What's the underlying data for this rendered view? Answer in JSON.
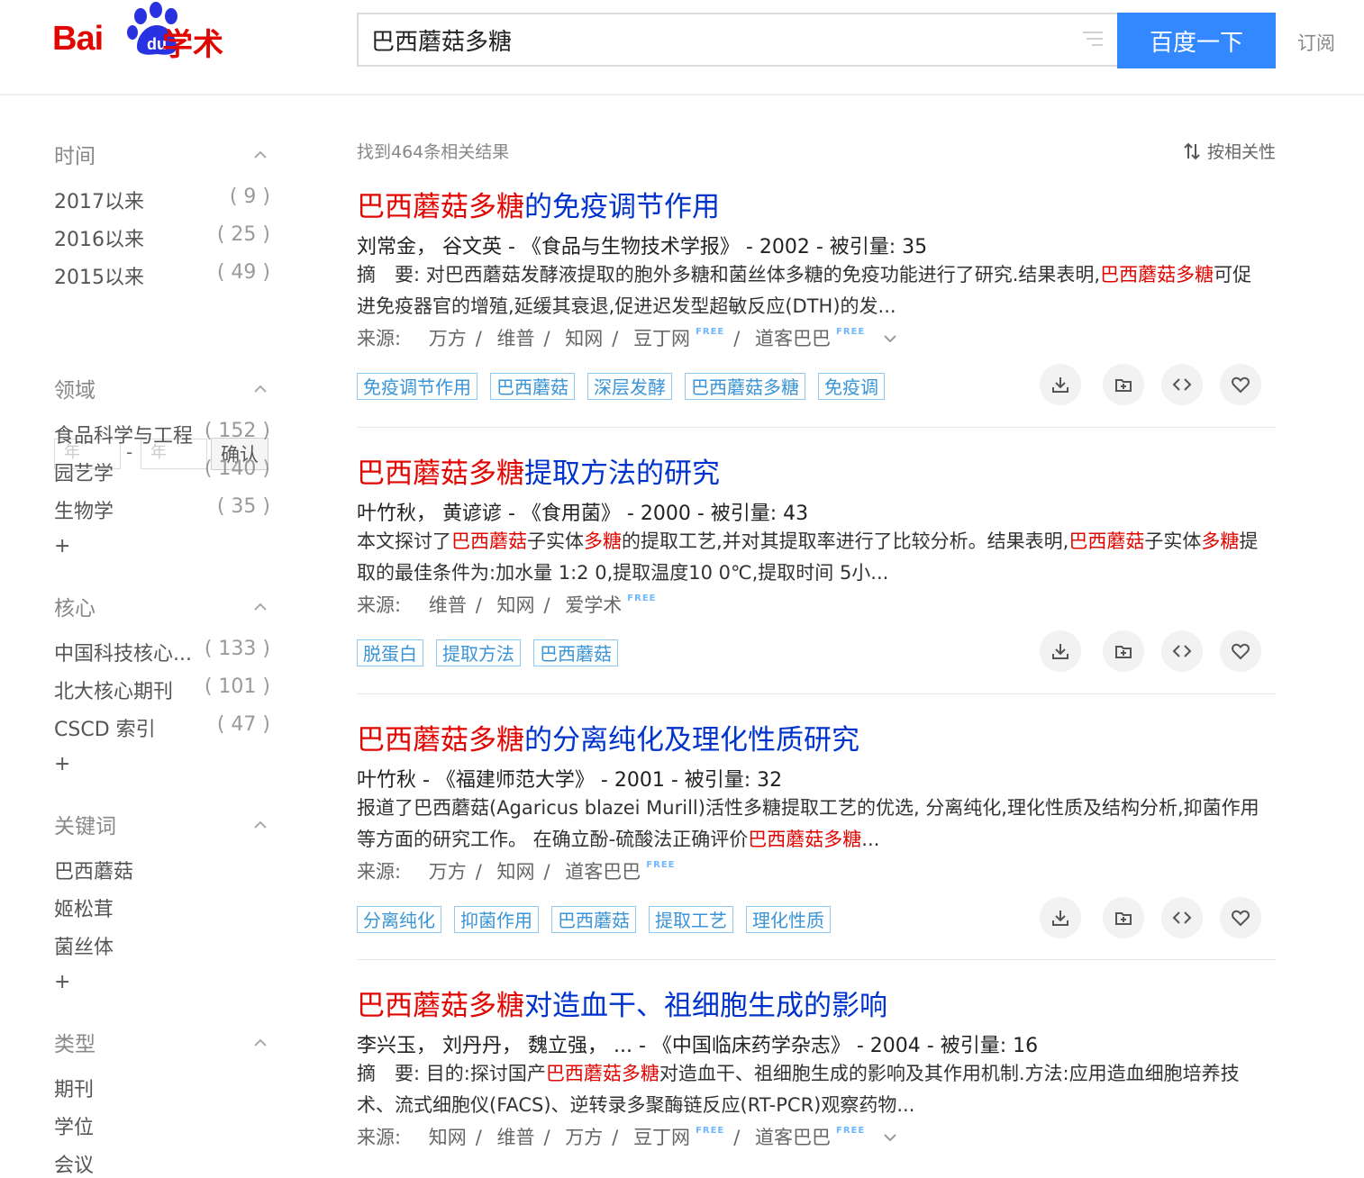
{
  "header": {
    "logo_bai": "Bai",
    "logo_du": "du",
    "logo_xueshu": "学术",
    "search_value": "巴西蘑菇多糖",
    "search_button": "百度一下",
    "subscribe": "订阅"
  },
  "sidebar": {
    "time": {
      "title": "时间",
      "items": [
        {
          "label": "2017以来",
          "count": "( 9 )"
        },
        {
          "label": "2016以来",
          "count": "( 25 )"
        },
        {
          "label": "2015以来",
          "count": "( 49 )"
        }
      ],
      "year_placeholder": "年",
      "dash": "-",
      "confirm": "确认"
    },
    "field": {
      "title": "领域",
      "items": [
        {
          "label": "食品科学与工程",
          "count": "( 152 )"
        },
        {
          "label": "园艺学",
          "count": "( 140 )"
        },
        {
          "label": "生物学",
          "count": "( 35 )"
        }
      ],
      "more": "+"
    },
    "core": {
      "title": "核心",
      "items": [
        {
          "label": "中国科技核心...",
          "count": "( 133 )"
        },
        {
          "label": "北大核心期刊",
          "count": "( 101 )"
        },
        {
          "label": "CSCD 索引",
          "count": "( 47 )"
        }
      ],
      "more": "+"
    },
    "keywords": {
      "title": "关键词",
      "items": [
        {
          "label": "巴西蘑菇"
        },
        {
          "label": "姬松茸"
        },
        {
          "label": "菌丝体"
        }
      ],
      "more": "+"
    },
    "type": {
      "title": "类型",
      "items": [
        {
          "label": "期刊"
        },
        {
          "label": "学位"
        },
        {
          "label": "会议"
        }
      ]
    }
  },
  "results_header": {
    "found": "找到464条相关结果",
    "sort": "按相关性"
  },
  "results": [
    {
      "title_hl": "巴西蘑菇多糖",
      "title_rest": "的免疫调节作用",
      "meta": "刘常金， 谷文英 - 《食品与生物技术学报》 - 2002 - 被引量: 35",
      "abs_1": "摘　要: 对巴西蘑菇发酵液提取的胞外多糖和菌丝体多糖的免疫功能进行了研究.结果表明,",
      "abs_hl1": "巴西蘑菇多糖",
      "abs_2": "可促进免疫器官的增殖,延缓其衰退,促进迟发型超敏反应(DTH)的发...",
      "source_label": "来源:",
      "sources": [
        "万方",
        "维普",
        "知网",
        "豆丁网",
        "道客巴巴"
      ],
      "free": "FREE",
      "tags": [
        "免疫调节作用",
        "巴西蘑菇",
        "深层发酵",
        "巴西蘑菇多糖",
        "免疫调"
      ]
    },
    {
      "title_hl": "巴西蘑菇多糖",
      "title_rest": "提取方法的研究",
      "meta": "叶竹秋， 黄谚谚 - 《食用菌》 - 2000 - 被引量: 43",
      "abs_1": "本文探讨了",
      "abs_hl1": "巴西蘑菇",
      "abs_2": "子实体",
      "abs_hl2": "多糖",
      "abs_3": "的提取工艺,并对其提取率进行了比较分析。结果表明,",
      "abs_hl3": "巴西蘑菇",
      "abs_4": "子实体",
      "abs_hl4": "多糖",
      "abs_5": "提取的最佳条件为:加水量 1:2 0,提取温度10 0℃,提取时间 5小...",
      "source_label": "来源:",
      "sources": [
        "维普",
        "知网",
        "爱学术"
      ],
      "free": "FREE",
      "tags": [
        "脱蛋白",
        "提取方法",
        "巴西蘑菇"
      ]
    },
    {
      "title_hl": "巴西蘑菇多糖",
      "title_rest": "的分离纯化及理化性质研究",
      "meta": "叶竹秋 - 《福建师范大学》 - 2001 - 被引量: 32",
      "abs_1": "报道了巴西蘑菇(Agaricus blazei Murill)活性多糖提取工艺的优选, 分离纯化,理化性质及结构分析,抑菌作用等方面的研究工作。 在确立酚-硫酸法正确评价",
      "abs_hl1": "巴西蘑菇多糖",
      "abs_2": "...",
      "source_label": "来源:",
      "sources": [
        "万方",
        "知网",
        "道客巴巴"
      ],
      "free": "FREE",
      "tags": [
        "分离纯化",
        "抑菌作用",
        "巴西蘑菇",
        "提取工艺",
        "理化性质"
      ]
    },
    {
      "title_hl": "巴西蘑菇多糖",
      "title_rest": "对造血干、祖细胞生成的影响",
      "meta": "李兴玉， 刘丹丹， 魏立强， ... - 《中国临床药学杂志》 - 2004 - 被引量: 16",
      "abs_1": "摘　要: 目的:探讨国产",
      "abs_hl1": "巴西蘑菇多糖",
      "abs_2": "对造血干、祖细胞生成的影响及其作用机制.方法:应用造血细胞培养技术、流式细胞仪(FACS)、逆转录多聚酶链反应(RT-PCR)观察药物...",
      "source_label": "来源:",
      "sources": [
        "知网",
        "维普",
        "万方",
        "豆丁网",
        "道客巴巴"
      ],
      "free": "FREE"
    }
  ],
  "colors": {
    "accent_blue": "#3388ff",
    "link_blue": "#0033cc",
    "highlight_red": "#e10601",
    "tag_blue": "#3a94d6"
  },
  "icons": [
    "filter-lines-icon",
    "sort-icon",
    "chevron-up-icon",
    "chevron-down-icon",
    "download-icon",
    "add-folder-icon",
    "cite-code-icon",
    "heart-icon"
  ]
}
